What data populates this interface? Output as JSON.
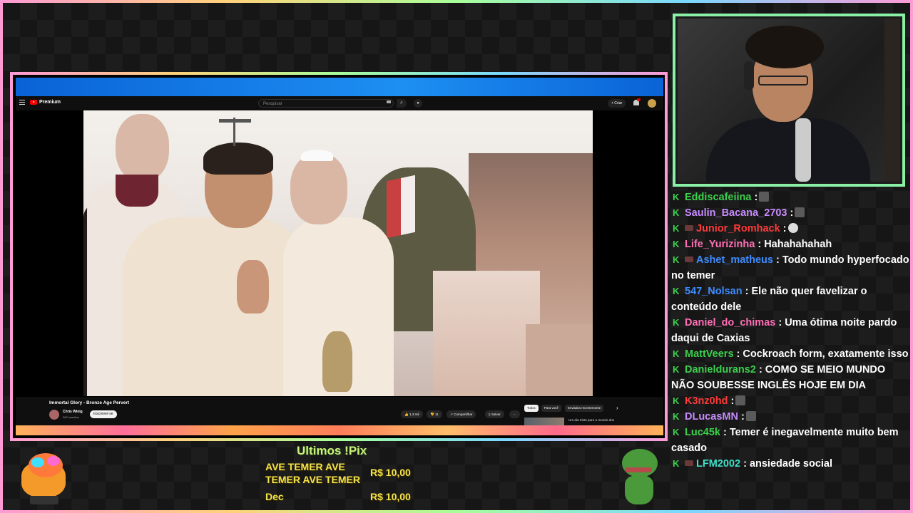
{
  "youtube": {
    "logo_text": "Premium",
    "search_placeholder": "Pesquisar",
    "create_label": "+ Criar",
    "video_title": "Immortal Glory - Bronze Age Pervert",
    "channel_name": "Chris Winig",
    "channel_subs": "362 inscritos",
    "subscribe_label": "Inscrever-se",
    "likes": "1,3 mil",
    "dislike_count": "11",
    "share_label": "Compartilhar",
    "save_label": "Salvar",
    "more_label": "···",
    "chips": [
      "Todos",
      "Para você",
      "Enviados recentemente"
    ],
    "chips_next": "›",
    "rec_title": "Um dia triste para o mundo dos"
  },
  "chat": {
    "messages": [
      {
        "user": "Eddiscafeiina",
        "color": "#3bd14c",
        "text": " :",
        "emote": "gray"
      },
      {
        "user": "Saulin_Bacana_2703",
        "color": "#c78cff",
        "text": " :",
        "emote": "gray"
      },
      {
        "user": "Junior_Romhack",
        "color": "#ff3a3a",
        "text": " :",
        "emote": "skull",
        "badge": true
      },
      {
        "user": "Life_Yurizinha",
        "color": "#ff6fb5",
        "text": " : Hahahahahah"
      },
      {
        "user": "Ashet_matheus",
        "color": "#3e8cff",
        "text": " : Todo mundo hyperfocado no temer",
        "badge": true
      },
      {
        "user": "547_Nolsan",
        "color": "#3e8cff",
        "text": " : Ele não quer favelizar o conteúdo dele"
      },
      {
        "user": "Daniel_do_chimas",
        "color": "#ff6fb5",
        "text": " : Uma ótima noite pardo daqui de Caxias"
      },
      {
        "user": "MattVeers",
        "color": "#3bd14c",
        "text": " : Cockroach form, exatamente isso"
      },
      {
        "user": "Danieldurans2",
        "color": "#3bd14c",
        "text": " : COMO SE MEIO MUNDO NÃO SOUBESSE INGLÊS HOJE EM DIA"
      },
      {
        "user": "K3nz0hd",
        "color": "#ff3a3a",
        "text": " :",
        "emote": "gray"
      },
      {
        "user": "DLucasMN",
        "color": "#c78cff",
        "text": " :",
        "emote": "gray"
      },
      {
        "user": "Luc45k",
        "color": "#3bd14c",
        "text": " : Temer é inegavelmente muito bem casado"
      },
      {
        "user": "LFM2002",
        "color": "#3ee0c8",
        "text": " : ansiedade social",
        "badge": true
      }
    ]
  },
  "pix": {
    "title": "Ultimos !Pix",
    "rows": [
      {
        "name": "AVE TEMER AVE TEMER AVE TEMER",
        "amount": "R$ 10,00"
      },
      {
        "name": "Dec",
        "amount": "R$ 10,00"
      }
    ]
  }
}
